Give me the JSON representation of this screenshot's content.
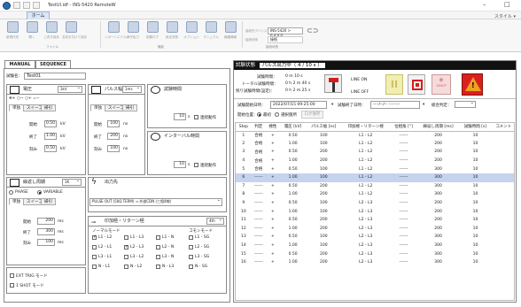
{
  "app": {
    "title": "TestUI.idf - INS-5420 RemoteW",
    "window_min": "–",
    "window_max": "□",
    "tab_home": "ホーム",
    "style_label": "スタイル ▾"
  },
  "ribbon": {
    "buttons": [
      "新規作成",
      "開く",
      "上書き保存",
      "名前を付けて保存",
      "ンポートエクスポート",
      "ログ出力",
      "試験ログ",
      "設定状態",
      "オプション",
      "マニュアル",
      "機種情報"
    ],
    "groups": [
      "ファイル",
      "機能",
      "接続状態"
    ],
    "device_label": "接続先デバイス",
    "device_value": "INS-5420 > 0.4.0.0",
    "status_label": "接続状態",
    "status_value": "接続"
  },
  "tabs": {
    "manual": "MANUAL",
    "sequence": "SEQUENCE"
  },
  "left": {
    "test_name_label": "試験名：",
    "test_name_value": "Test01",
    "voltage": {
      "title": "電圧",
      "range": "3kV",
      "polarity": "⊕+ ○− ○+ =−",
      "tab1": "単独",
      "tab2": "スイープ",
      "tab3": "掃引",
      "start_label": "開始",
      "start": "0.50",
      "end_label": "終了",
      "end": "1.00",
      "step_label": "刻み",
      "step": "0.50",
      "unit": "kV"
    },
    "pulse": {
      "title": "パルス幅",
      "range": "1ms",
      "tab1": "単独",
      "tab2": "スイープ",
      "tab3": "掃引",
      "start_label": "開始",
      "start": "100",
      "end_label": "終了",
      "end": "200",
      "step_label": "刻み",
      "step": "100",
      "unit": "ns"
    },
    "test_time": {
      "title": "試験時間",
      "value": "10",
      "unit": "s",
      "cont": "連続動作"
    },
    "interval": {
      "title": "インターバル時間",
      "value": "10",
      "unit": "s",
      "cont": "連続動作"
    },
    "period": {
      "title": "繰返し周期",
      "range": "1K",
      "phase": "PHASE",
      "variable": "VARIABLE",
      "tab1": "単独",
      "tab2": "スイープ",
      "tab3": "掃引",
      "start_label": "開始",
      "start": "200",
      "end_label": "終了",
      "end": "300",
      "step_label": "刻み",
      "step": "100",
      "unit": "ms"
    },
    "output": {
      "title": "出力先",
      "value": "PULSE OUT (50Ω TERM) ⇒ 外部CDN (三相4線)"
    },
    "switch": {
      "title": "印加極・リターン極",
      "range": "4th",
      "normal": "ノーマルモード",
      "common": "コモンモード",
      "normal_items": [
        "L1 - L2",
        "L1 - L3",
        "L1 - N",
        "L2 - L1",
        "L2 - L3",
        "L2 - N",
        "L3 - L1",
        "L3 - L2",
        "L3 - N",
        "N - L1",
        "N - L2",
        "N - L3"
      ],
      "common_items": [
        "L1 - SG",
        "L2 - SG",
        "L3 - SG",
        "N - SG"
      ]
    },
    "ext_trig": "EXT TRIG モード",
    "one_shot": "1 SHOT モード"
  },
  "right": {
    "status_label": "試験状態",
    "status_value": "パルス出力中（ 4 / 10 s ）",
    "time_label": "試験時間：",
    "time_value": "0 m 10 s",
    "total_label": "トータル試験時間：",
    "total_value": "0 h  2 m 40 s",
    "remain_label": "残り試験時間(設定)：",
    "remain_value": "0 h  2 m 25 s",
    "line_on": "LINE ON",
    "line_off": "LINE OFF",
    "start_dt_label": "試験開始日時：",
    "start_dt": "2022/07/15 09:25:00",
    "end_dt_label": "試験終了日時：",
    "end_dt": "----/--/-- --:--:--",
    "judge_label": "総合判定：",
    "pos_label": "開始位置：",
    "pos_first": "最初",
    "pos_sel": "選択箇所",
    "log_btn": "ログ保存",
    "columns": [
      "Step",
      "判定",
      "極性",
      "電圧 [kV]",
      "パルス幅 [ns]",
      "印加極・リターン極",
      "位相角 [°]",
      "繰返し周期 [ms]",
      "試験時間 [s]",
      "コメント"
    ],
    "rows": [
      [
        "1",
        "合格",
        "+",
        "0.50",
        "100",
        "L1 - L2",
        "------",
        "200",
        "10",
        ""
      ],
      [
        "2",
        "合格",
        "+",
        "1.00",
        "100",
        "L1 - L2",
        "------",
        "200",
        "10",
        ""
      ],
      [
        "3",
        "合格",
        "+",
        "0.50",
        "200",
        "L1 - L2",
        "------",
        "200",
        "10",
        ""
      ],
      [
        "4",
        "合格",
        "+",
        "1.00",
        "200",
        "L1 - L2",
        "------",
        "200",
        "10",
        ""
      ],
      [
        "5",
        "合格",
        "+",
        "0.50",
        "100",
        "L1 - L2",
        "------",
        "300",
        "10",
        ""
      ],
      [
        "6",
        "------",
        "+",
        "1.00",
        "100",
        "L1 - L2",
        "------",
        "300",
        "10",
        ""
      ],
      [
        "7",
        "------",
        "+",
        "0.50",
        "200",
        "L1 - L2",
        "------",
        "300",
        "10",
        ""
      ],
      [
        "8",
        "------",
        "+",
        "1.00",
        "200",
        "L1 - L2",
        "------",
        "300",
        "10",
        ""
      ],
      [
        "9",
        "------",
        "+",
        "0.50",
        "100",
        "L2 - L3",
        "------",
        "200",
        "10",
        ""
      ],
      [
        "10",
        "------",
        "+",
        "1.00",
        "100",
        "L2 - L3",
        "------",
        "200",
        "10",
        ""
      ],
      [
        "11",
        "------",
        "+",
        "0.50",
        "200",
        "L2 - L3",
        "------",
        "200",
        "10",
        ""
      ],
      [
        "12",
        "------",
        "+",
        "1.00",
        "200",
        "L2 - L3",
        "------",
        "200",
        "10",
        ""
      ],
      [
        "13",
        "------",
        "+",
        "0.50",
        "100",
        "L2 - L3",
        "------",
        "300",
        "10",
        ""
      ],
      [
        "14",
        "------",
        "+",
        "1.00",
        "100",
        "L2 - L3",
        "------",
        "300",
        "10",
        ""
      ],
      [
        "15",
        "------",
        "+",
        "0.50",
        "200",
        "L2 - L3",
        "------",
        "300",
        "10",
        ""
      ],
      [
        "16",
        "------",
        "+",
        "1.00",
        "200",
        "L2 - L3",
        "------",
        "300",
        "10",
        ""
      ]
    ],
    "selected_row": 5,
    "btn_pause": "II",
    "btn_stop": "■",
    "btn_shot": "1SHOT",
    "btn_warn": "!"
  }
}
